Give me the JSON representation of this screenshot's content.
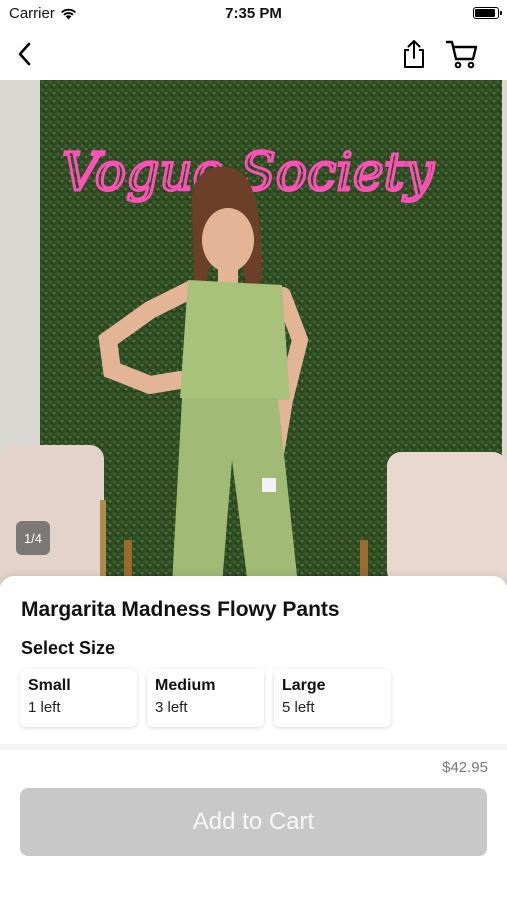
{
  "status_bar": {
    "carrier": "Carrier",
    "time": "7:35 PM",
    "battery_level": 0.95
  },
  "nav": {
    "back_icon": "chevron-left-icon",
    "share_icon": "share-icon",
    "cart_icon": "cart-icon"
  },
  "hero": {
    "neon_sign_text": "Vogue Society",
    "photo_counter": "1/4"
  },
  "product": {
    "title": "Margarita Madness Flowy Pants",
    "select_size_label": "Select Size",
    "sizes": [
      {
        "name": "Small",
        "stock": "1 left"
      },
      {
        "name": "Medium",
        "stock": "3 left"
      },
      {
        "name": "Large",
        "stock": "5 left"
      }
    ],
    "price": "$42.95",
    "add_to_cart_label": "Add to Cart"
  },
  "colors": {
    "neon": "#ff3aa8",
    "outfit": "#a9c47f",
    "hedge": "#2f4d24",
    "button_disabled": "#c8c8c8"
  }
}
